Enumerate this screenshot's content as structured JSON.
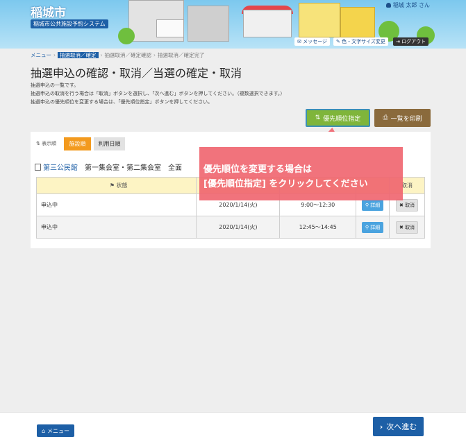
{
  "header": {
    "city": "稲城市",
    "system": "稲城市公共施設予約システム",
    "user": "稲城 太郎 さん",
    "messages": "メッセージ",
    "color_size": "色・文字サイズ変更",
    "logout": "ログアウト"
  },
  "breadcrumb": {
    "menu": "メニュー",
    "current": "抽選取消／確定",
    "step2": "抽選取消／確定確認",
    "step3": "抽選取消／確定完了"
  },
  "page": {
    "title": "抽選申込の確認・取消／当選の確定・取消",
    "desc1": "抽選申込の一覧です。",
    "desc2": "抽選申込の取消を行う場合は「取消」ボタンを選択し、「次へ進む」ボタンを押してください。（複数選択できます。）",
    "desc3": "抽選申込の優先順位を変更する場合は、「優先順位指定」ボタンを押してください。"
  },
  "actions": {
    "priority": "優先順位指定",
    "print": "一覧を印刷"
  },
  "sort": {
    "label": "表示順",
    "by_facility": "施設順",
    "by_date": "利用日順"
  },
  "facility": {
    "name": "第三公民館",
    "rooms": "第一集会室・第二集会室　全面"
  },
  "table": {
    "headers": {
      "status": "状態",
      "cancel": "取消"
    },
    "rows": [
      {
        "status": "申込中",
        "date": "2020/1/14(火)",
        "time": "9:00～12:30",
        "detail": "詳細",
        "cancel": "取消"
      },
      {
        "status": "申込中",
        "date": "2020/1/14(火)",
        "time": "12:45～14:45",
        "detail": "詳細",
        "cancel": "取消"
      }
    ]
  },
  "callout": {
    "line1": "優先順位を変更する場合は",
    "line2": "[優先順位指定] をクリックしてください"
  },
  "footer": {
    "menu": "メニュー",
    "next": "次へ進む"
  }
}
